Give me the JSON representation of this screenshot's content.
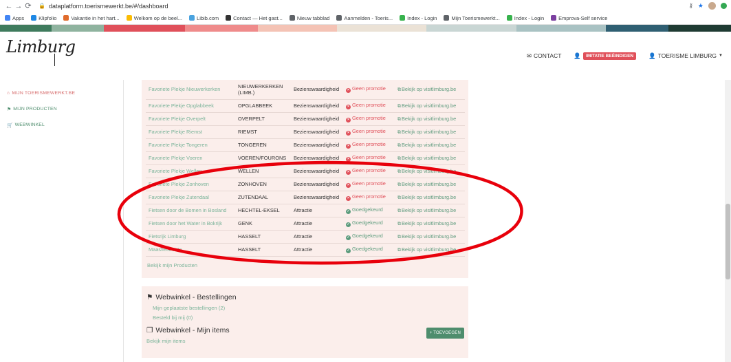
{
  "browser": {
    "url": "dataplatform.toerismewerkt.be/#/dashboard",
    "bookmarks": [
      "Apps",
      "Klipfolio",
      "Vakantie in het hart...",
      "Welkom op de beel...",
      "Libib.com",
      "Contact — Het gast...",
      "Nieuw tabblad",
      "Aanmelden - Toeris...",
      "Index - Login",
      "Mijn Toerismewerkt...",
      "Index - Login",
      "Emprova-Self service"
    ],
    "bookmark_colors": [
      "#4285f4",
      "#1e88e5",
      "#e06b2c",
      "#fbbc04",
      "#4aa3df",
      "#333333",
      "#5f6368",
      "#5f6368",
      "#37b24d",
      "#5f6368",
      "#37b24d",
      "#7b3fa0"
    ]
  },
  "color_strip": [
    "#3f7b5d",
    "#8fb39f",
    "#e0505a",
    "#ef8b8b",
    "#f4c3b5",
    "#ebe2d6",
    "#c9d6d4",
    "#a9c2c3",
    "#2f5f72",
    "#1f3b33"
  ],
  "header": {
    "logo": "Limburg",
    "contact": "CONTACT",
    "imitatie": "IMITATIE BEËINDIGEN",
    "user": "TOERISME LIMBURG"
  },
  "sidebar": {
    "items": [
      {
        "label": "MIJN TOERISMEWERKT.BE",
        "active": true
      },
      {
        "label": "MIJN PRODUCTEN",
        "active": false
      },
      {
        "label": "WEBWINKEL",
        "active": false
      }
    ]
  },
  "products": {
    "rows": [
      {
        "name": "Favoriete Plekje Nieuwerkerken",
        "place": "NIEUWERKERKEN (LIMB.)",
        "category": "Bezienswaardigheid",
        "status": "Geen promotie",
        "ok": false,
        "link": "Bekijk op visitlimburg.be"
      },
      {
        "name": "Favoriete Plekje Opglabbeek",
        "place": "OPGLABBEEK",
        "category": "Bezienswaardigheid",
        "status": "Geen promotie",
        "ok": false,
        "link": "Bekijk op visitlimburg.be"
      },
      {
        "name": "Favoriete Plekje Overpelt",
        "place": "OVERPELT",
        "category": "Bezienswaardigheid",
        "status": "Geen promotie",
        "ok": false,
        "link": "Bekijk op visitlimburg.be"
      },
      {
        "name": "Favoriete Plekje Riemst",
        "place": "RIEMST",
        "category": "Bezienswaardigheid",
        "status": "Geen promotie",
        "ok": false,
        "link": "Bekijk op visitlimburg.be"
      },
      {
        "name": "Favoriete Plekje Tongeren",
        "place": "TONGEREN",
        "category": "Bezienswaardigheid",
        "status": "Geen promotie",
        "ok": false,
        "link": "Bekijk op visitlimburg.be"
      },
      {
        "name": "Favoriete Plekje Voeren",
        "place": "VOEREN/FOURONS",
        "category": "Bezienswaardigheid",
        "status": "Geen promotie",
        "ok": false,
        "link": "Bekijk op visitlimburg.be"
      },
      {
        "name": "Favoriete Plekje Wellen",
        "place": "WELLEN",
        "category": "Bezienswaardigheid",
        "status": "Geen promotie",
        "ok": false,
        "link": "Bekijk op visitlimburg.be"
      },
      {
        "name": "Favoriete Plekje Zonhoven",
        "place": "ZONHOVEN",
        "category": "Bezienswaardigheid",
        "status": "Geen promotie",
        "ok": false,
        "link": "Bekijk op visitlimburg.be"
      },
      {
        "name": "Favoriete Plekje Zutendaal",
        "place": "ZUTENDAAL",
        "category": "Bezienswaardigheid",
        "status": "Geen promotie",
        "ok": false,
        "link": "Bekijk op visitlimburg.be"
      },
      {
        "name": "Fietsen door de Bomen in Bosland",
        "place": "HECHTEL-EKSEL",
        "category": "Attractie",
        "status": "Goedgekeurd",
        "ok": true,
        "link": "Bekijk op visitlimburg.be"
      },
      {
        "name": "Fietsen door het Water in Bokrijk",
        "place": "GENK",
        "category": "Attractie",
        "status": "Goedgekeurd",
        "ok": true,
        "link": "Bekijk op visitlimburg.be"
      },
      {
        "name": "Fietsrijk Limburg",
        "place": "HASSELT",
        "category": "Attractie",
        "status": "Goedgekeurd",
        "ok": true,
        "link": "Bekijk op visitlimburg.be"
      },
      {
        "name": "Maasfietsroute",
        "place": "HASSELT",
        "category": "Attractie",
        "status": "Goedgekeurd",
        "ok": true,
        "link": "Bekijk op visitlimburg.be"
      }
    ],
    "view_all": "Bekijk mijn Producten"
  },
  "webshop": {
    "orders_title": "Webwinkel - Bestellingen",
    "my_orders": "Mijn geplaatste bestellingen (2)",
    "ordered_from_me": "Besteld bij mij (0)",
    "items_title": "Webwinkel - Mijn items",
    "add_button": "+ TOEVOEGEN",
    "view_items": "Bekijk mijn items"
  },
  "annotation_color": "#e8000b"
}
